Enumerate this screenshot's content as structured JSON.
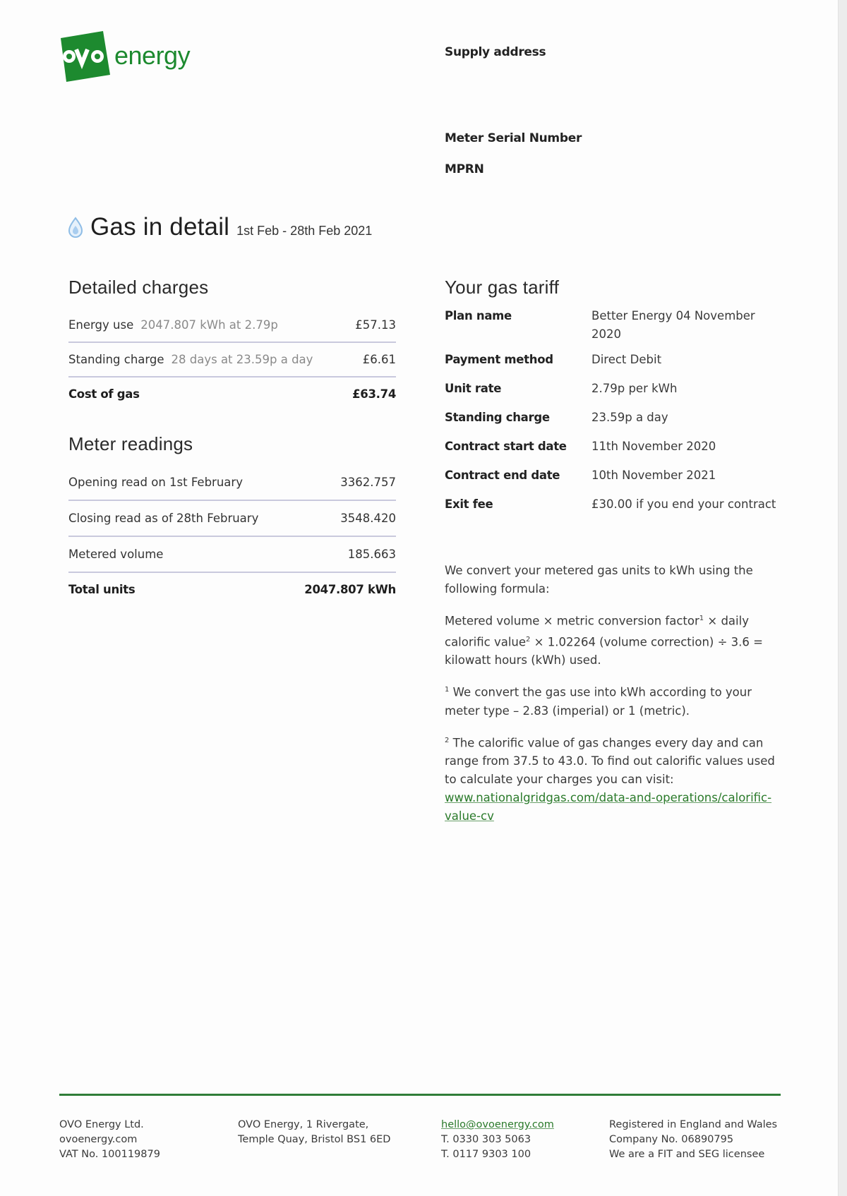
{
  "brand": {
    "logo_mark": "ovo",
    "logo_word": "energy",
    "brand_color": "#1d8a2f"
  },
  "supply": {
    "address_label": "Supply address",
    "meter_serial_label": "Meter Serial Number",
    "mprn_label": "MPRN"
  },
  "title": {
    "icon": "gas-drop-icon",
    "heading": "Gas in detail",
    "period": "1st Feb - 28th Feb 2021"
  },
  "charges": {
    "heading": "Detailed charges",
    "rows": [
      {
        "label": "Energy use",
        "detail": "2047.807 kWh at 2.79p",
        "amount": "£57.13"
      },
      {
        "label": "Standing charge",
        "detail": "28 days at 23.59p a day",
        "amount": "£6.61"
      }
    ],
    "total": {
      "label": "Cost of gas",
      "amount": "£63.74"
    }
  },
  "readings": {
    "heading": "Meter readings",
    "rows": [
      {
        "label": "Opening read on 1st February",
        "value": "3362.757"
      },
      {
        "label": "Closing read as of 28th February",
        "value": "3548.420"
      },
      {
        "label": "Metered volume",
        "value": "185.663"
      }
    ],
    "total": {
      "label": "Total units",
      "value": "2047.807 kWh"
    }
  },
  "tariff": {
    "heading": "Your gas tariff",
    "rows": [
      {
        "key": "Plan name",
        "value": "Better Energy 04 November 2020"
      },
      {
        "key": "Payment method",
        "value": "Direct Debit"
      },
      {
        "key": "Unit rate",
        "value": "2.79p per kWh"
      },
      {
        "key": "Standing charge",
        "value": "23.59p a day"
      },
      {
        "key": "Contract start date",
        "value": "11th November 2020"
      },
      {
        "key": "Contract end date",
        "value": "10th November 2021"
      },
      {
        "key": "Exit fee",
        "value": "£30.00 if you end your contract"
      }
    ]
  },
  "notes": {
    "intro": "We convert your metered gas units to kWh using the following formula:",
    "formula_part1": "Metered volume × metric conversion factor",
    "formula_sup1": "1",
    "formula_part2": " × daily calorific value",
    "formula_sup2": "2",
    "formula_part3": " × 1.02264 (volume correction) ÷ 3.6 = kilowatt hours (kWh) used.",
    "footnote1_marker": "1",
    "footnote1": " We convert the gas use into kWh according to your meter type – 2.83 (imperial) or 1 (metric).",
    "footnote2_marker": "2",
    "footnote2": " The calorific value of gas changes every day and can range from 37.5 to 43.0. To find out calorific values used to calculate your charges you can visit:",
    "link": "www.nationalgridgas.com/data-and-operations/calorific-value-cv"
  },
  "footer": {
    "col1": [
      "OVO Energy Ltd.",
      "ovoenergy.com",
      "VAT No. 100119879"
    ],
    "col2": [
      "OVO Energy, 1 Rivergate,",
      "Temple Quay, Bristol BS1 6ED"
    ],
    "email": "hello@ovoenergy.com",
    "phones": [
      "T. 0330 303 5063",
      "T. 0117 9303 100"
    ],
    "col4": [
      "Registered in England and Wales",
      "Company No. 06890795",
      "We are a FIT and SEG licensee"
    ]
  }
}
